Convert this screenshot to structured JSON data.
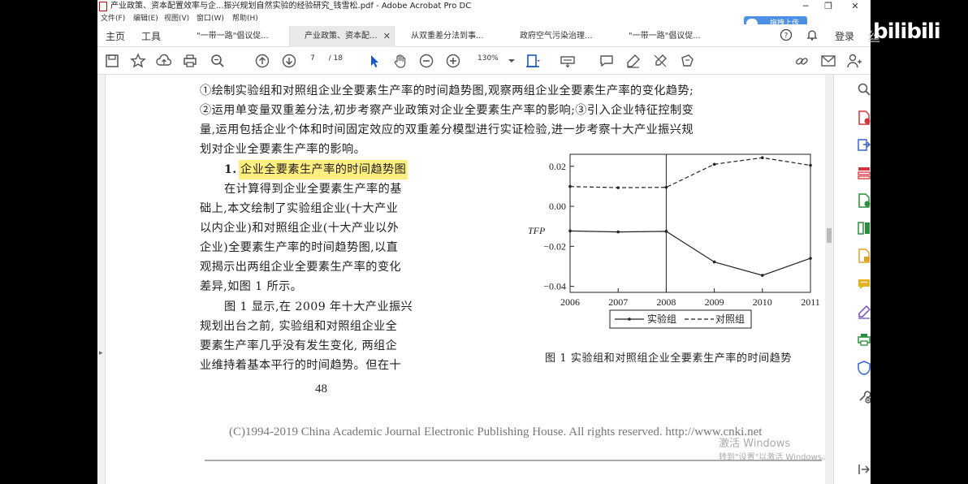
{
  "window": {
    "title": "产业政策、资本配置效率与企...振兴规划自然实验的经验研究_钱雪松.pdf - Adobe Acrobat Pro DC",
    "controls": {
      "minimize": "─",
      "maximize": "❐",
      "close": "✕"
    }
  },
  "menu": [
    "文件(F)",
    "编辑(E)",
    "视图(V)",
    "窗口(W)",
    "帮助(H)"
  ],
  "tabs": {
    "home": "主页",
    "tools": "工具",
    "docs": [
      {
        "label": "\"一带一路\"倡议促...",
        "active": false
      },
      {
        "label": "产业政策、资本配...",
        "active": true
      },
      {
        "label": "从双重差分法到事...",
        "active": false
      },
      {
        "label": "政府空气污染治理...",
        "active": false
      },
      {
        "label": "\"一带一路\"倡议促...",
        "active": false
      }
    ],
    "close_glyph": "✕",
    "login": "登录",
    "upload": "拖拽上传"
  },
  "toolbar": {
    "page_current": "7",
    "page_total": "/ 18",
    "zoom": "130%"
  },
  "page": {
    "lines": [
      "①绘制实验组和对照组企业全要素生产率的时间趋势图,观察两组企业全要素生产率的变化趋势;",
      "②运用单变量双重差分法,初步考察产业政策对企业全要素生产率的影响;③引入企业特征控制变",
      "量,运用包括企业个体和时间固定效应的双重差分模型进行实证检验,进一步考察十大产业振兴规",
      "划对企业全要素生产率的影响。"
    ],
    "heading_num": "1.",
    "heading": "企业全要素生产率的时间趋势图",
    "para1": [
      "在计算得到企业全要素生产率的基",
      "础上,本文绘制了实验组企业(十大产业",
      "以内企业)和对照组企业(十大产业以外",
      "企业)全要素生产率的时间趋势图,以直",
      "观揭示出两组企业全要素生产率的变化",
      "差异,如图 1 所示。"
    ],
    "para2": [
      "图 1 显示,在 2009 年十大产业振兴",
      "规划出台之前, 实验组和对照组企业全",
      "要素生产率几乎没有发生变化, 两组企",
      "业维持着基本平行的时间趋势。但在十"
    ],
    "caption": "图 1    实验组和对照组企业全要素生产率的时间趋势",
    "page_number": "48",
    "copyright": "(C)1994-2019 China Academic Journal Electronic Publishing House. All rights reserved.    http://www.cnki.net"
  },
  "chart_data": {
    "type": "line",
    "x": [
      2006,
      2007,
      2008,
      2009,
      2010,
      2011
    ],
    "series": [
      {
        "name": "实验组",
        "values": [
          -0.0123,
          -0.0128,
          -0.0125,
          -0.0278,
          -0.0345,
          -0.026
        ],
        "style": "solid"
      },
      {
        "name": "对照组",
        "values": [
          0.0099,
          0.0093,
          0.0095,
          0.021,
          0.0243,
          0.0205
        ],
        "style": "dashed"
      }
    ],
    "ylabel": "TFP",
    "ylim": [
      -0.043,
      0.026
    ],
    "xlim": [
      2006,
      2011
    ],
    "yticks": [
      "0.02",
      "0.00",
      "−0.02",
      "−0.04"
    ],
    "ytick_values": [
      0.02,
      0.0,
      -0.02,
      -0.04
    ],
    "xticks": [
      "2006",
      "2007",
      "2008",
      "2009",
      "2010",
      "2011"
    ],
    "vline": 2008,
    "legend": "bottom"
  },
  "watermark": {
    "line1": "激活 Windows",
    "line2": "转到\"设置\"以激活 Windows。"
  },
  "overlay": {
    "site": "bilibili",
    "prefix": "丝"
  }
}
